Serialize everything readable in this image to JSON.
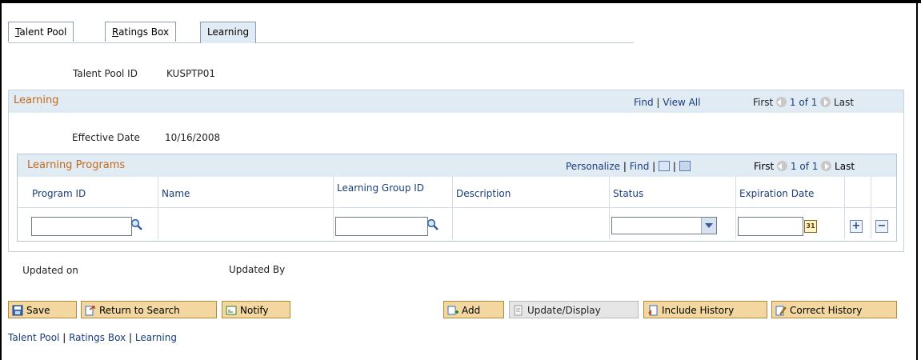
{
  "tabs": [
    {
      "label": "Talent Pool",
      "underline": "T",
      "rest": "alent Pool",
      "active": false
    },
    {
      "label": "Ratings Box",
      "underline": "R",
      "rest": "atings Box",
      "active": false
    },
    {
      "label": "Learning",
      "active": true
    }
  ],
  "header": {
    "talent_pool_id_label": "Talent Pool ID",
    "talent_pool_id_value": "KUSPTP01"
  },
  "learning_box": {
    "title": "Learning",
    "find": "Find",
    "view_all": "View All",
    "first": "First",
    "range": "1 of 1",
    "last": "Last",
    "effective_date_label": "Effective Date",
    "effective_date_value": "10/16/2008"
  },
  "programs_grid": {
    "title": "Learning Programs",
    "personalize": "Personalize",
    "find": "Find",
    "first": "First",
    "range": "1 of 1",
    "last": "Last",
    "columns": {
      "program_id": "Program ID",
      "name": "Name",
      "learning_group_id": "Learning Group ID",
      "description": "Description",
      "status": "Status",
      "expiration_date": "Expiration Date"
    },
    "row": {
      "program_id": "",
      "learning_group_id": "",
      "status": "",
      "expiration_date": ""
    }
  },
  "audit": {
    "updated_on_label": "Updated on",
    "updated_by_label": "Updated By"
  },
  "buttons": {
    "save": "Save",
    "return_to_search": "Return to Search",
    "notify": "Notify",
    "add": "Add",
    "update_display": "Update/Display",
    "include_history": "Include History",
    "correct_history": "Correct History"
  },
  "footer_links": {
    "talent_pool": "Talent Pool",
    "ratings_box": "Ratings Box",
    "learning": "Learning"
  },
  "colors": {
    "section_title": "#c26a1a",
    "link": "#1a3e7a",
    "header_band": "#e1ebf4",
    "button_fill": "#f2d8a0"
  }
}
